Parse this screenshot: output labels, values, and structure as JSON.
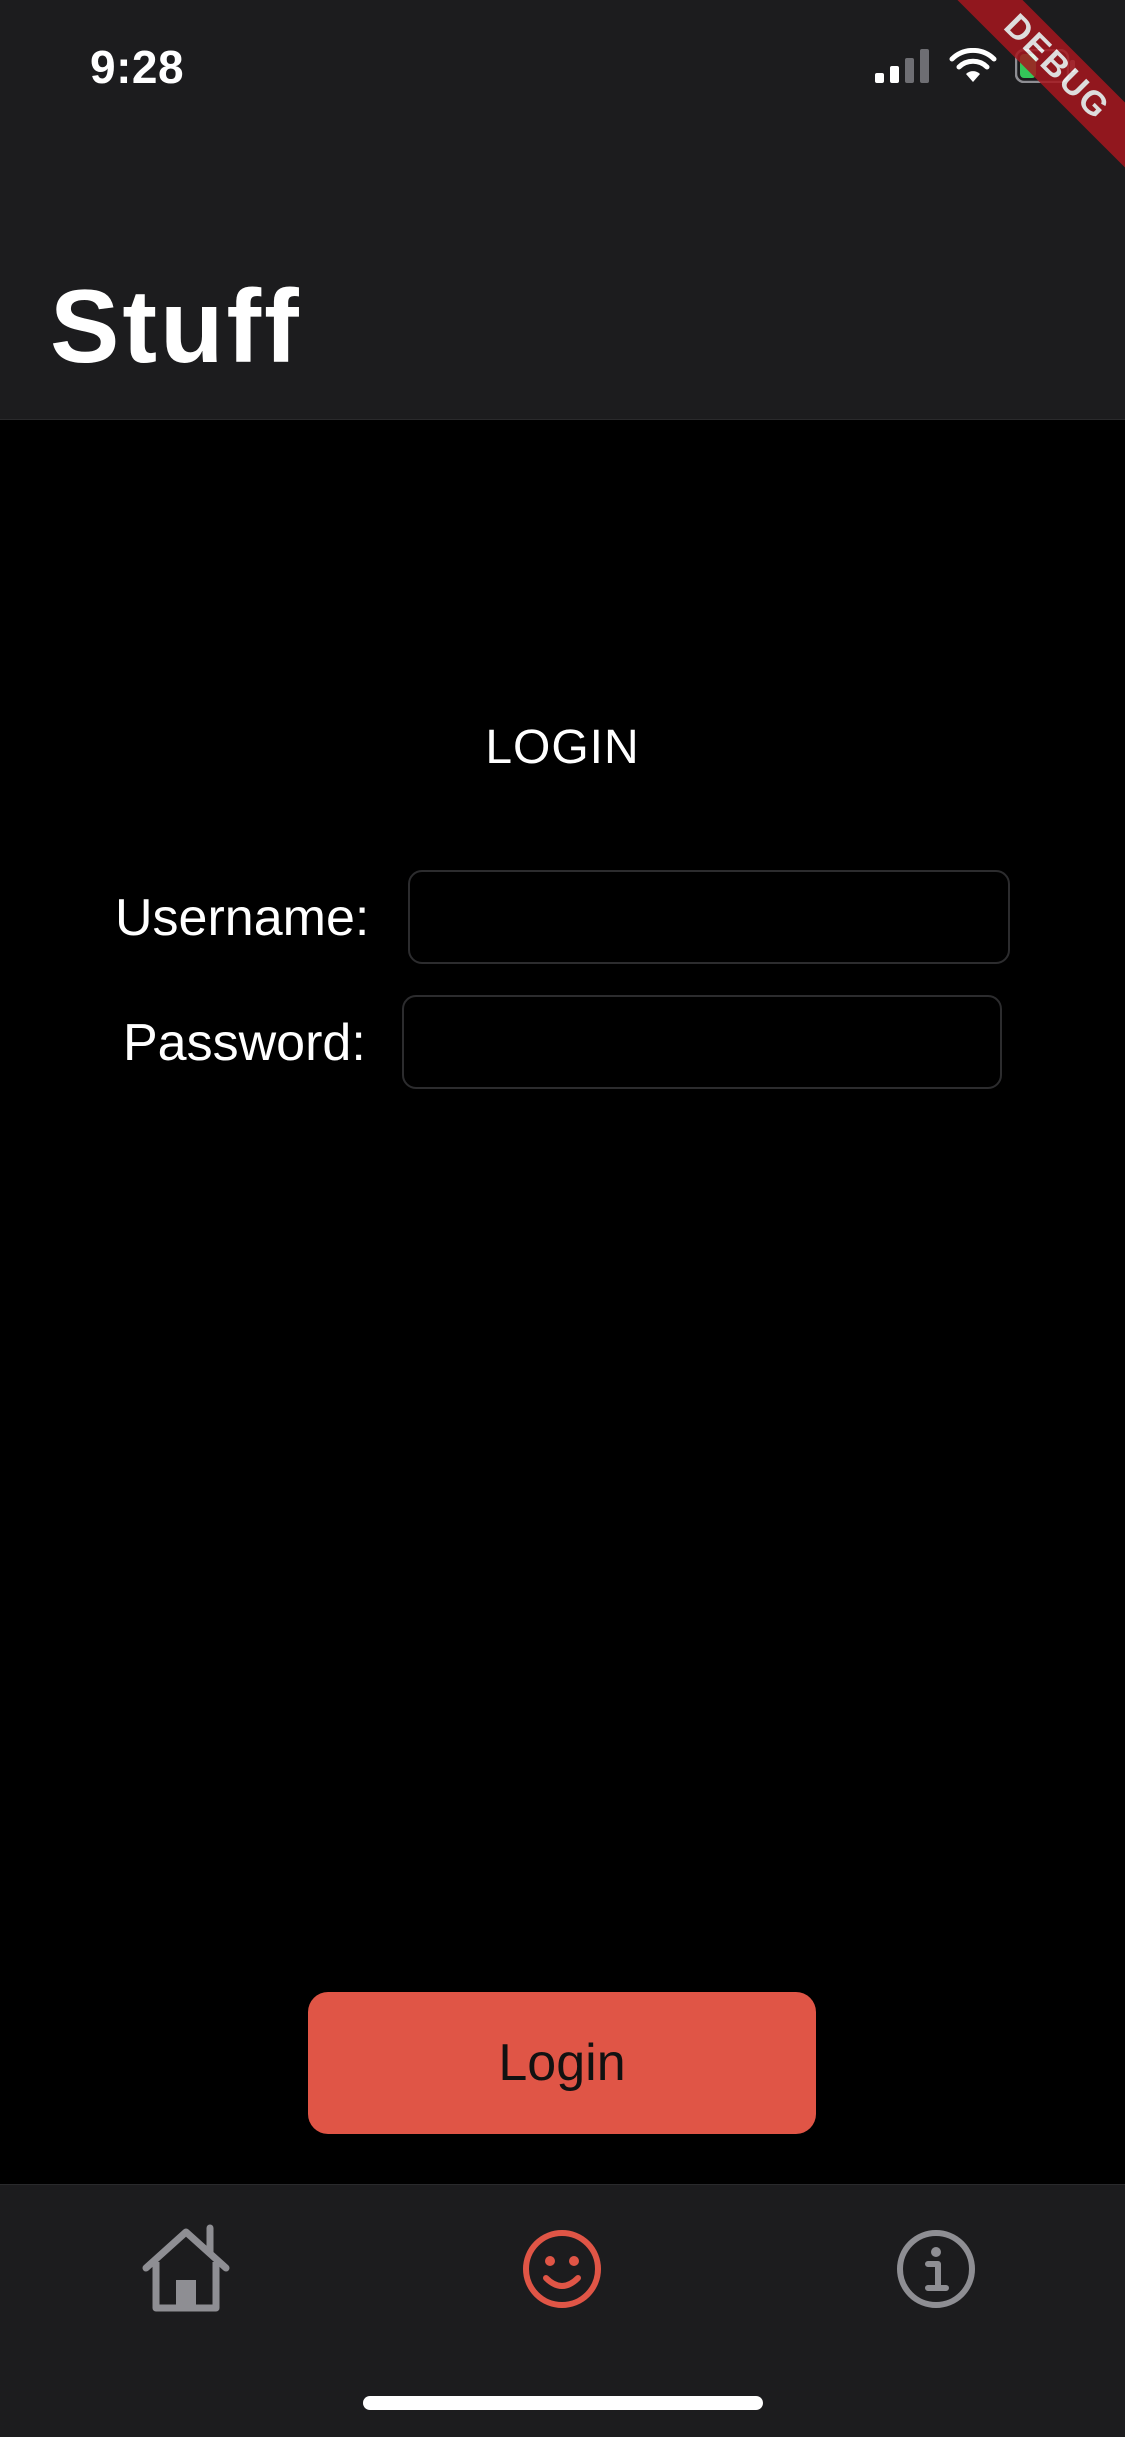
{
  "status_bar": {
    "time": "9:28",
    "debug_label": "DEBUG"
  },
  "header": {
    "title": "Stuff"
  },
  "login_form": {
    "heading": "LOGIN",
    "username_label": "Username:",
    "username_value": "",
    "password_label": "Password:",
    "password_value": "",
    "submit_label": "Login"
  },
  "tabbar": {
    "items": [
      {
        "icon": "home-icon",
        "active": false
      },
      {
        "icon": "smiley-icon",
        "active": true
      },
      {
        "icon": "info-icon",
        "active": false
      }
    ]
  },
  "colors": {
    "accent": "#e05546",
    "bar_background": "#1c1c1e",
    "page_background": "#000000",
    "inactive_icon": "#8e8e93"
  }
}
